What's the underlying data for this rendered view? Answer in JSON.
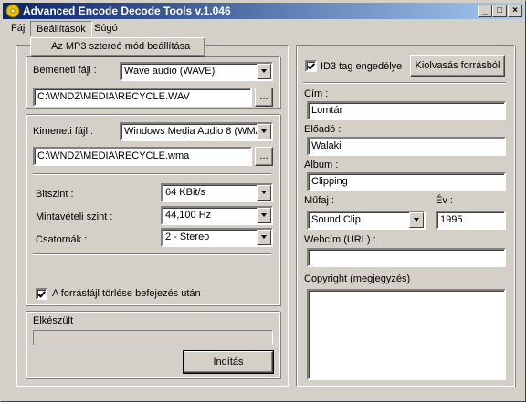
{
  "window": {
    "title": "Advanced Encode Decode Tools v.1.046",
    "icon": "disc-app-icon",
    "controls": {
      "minimize": "_",
      "maximize": "□",
      "close": "×"
    }
  },
  "menu": {
    "file": "Fájl",
    "settings": "Beállítások",
    "help": "Súgó",
    "dropdown_item": "Az MP3 sztereó mód beállítása"
  },
  "input": {
    "label": "Bemeneti fájl :",
    "format": "Wave audio (WAVE)",
    "path": "C:\\WNDZ\\MEDIA\\RECYCLE.WAV",
    "browse": "..."
  },
  "output": {
    "label": "Kimeneti fájl :",
    "format": "Windows Media Audio 8 (WMA",
    "path": "C:\\WNDZ\\MEDIA\\RECYCLE.wma",
    "browse": "..."
  },
  "settings": {
    "bitrate_label": "Bitszint :",
    "bitrate_value": "64 KBit/s",
    "samplerate_label": "Mintavételi szint :",
    "samplerate_value": "44,100 Hz",
    "channels_label": "Csatornák :",
    "channels_value": "2 - Stereo",
    "delete_source_label": "A forrásfájl törlése befejezés után",
    "delete_source_checked": true
  },
  "status": {
    "label": "Elkészült",
    "progress": 0,
    "start_button": "Indítás"
  },
  "id3": {
    "enable_label": "ID3 tag engedélye",
    "enable_checked": true,
    "read_button": "Kiolvasás forrásból",
    "title_label": "Cím :",
    "title_value": "Lomtár",
    "artist_label": "Előadó :",
    "artist_value": "Walaki",
    "album_label": "Album :",
    "album_value": "Clipping",
    "genre_label": "Műfaj :",
    "genre_value": "Sound Clip",
    "year_label": "Év :",
    "year_value": "1995",
    "url_label": "Webcím (URL) :",
    "url_value": "",
    "copyright_label": "Copyright (megjegyzés)",
    "copyright_value": ""
  }
}
